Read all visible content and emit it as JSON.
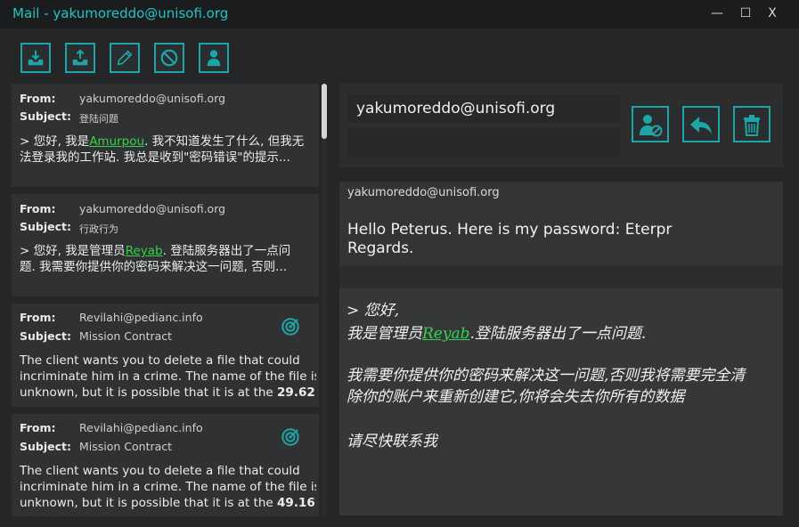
{
  "window": {
    "title": "Mail - yakumoreddo@unisofi.org",
    "controls": {
      "minimize": "—",
      "maximize": "☐",
      "close": "X"
    }
  },
  "toolbar": {
    "buttons": [
      {
        "name": "inbox-icon"
      },
      {
        "name": "outbox-icon"
      },
      {
        "name": "compose-icon"
      },
      {
        "name": "block-icon"
      },
      {
        "name": "contact-icon"
      }
    ]
  },
  "labels": {
    "from": "From:",
    "subject": "Subject:"
  },
  "messages": [
    {
      "from": "yakumoreddo@unisofi.org",
      "subject": "登陆问题",
      "s1a": "> 您好, 我是",
      "s1h": "Amurpou",
      "s1b": ". 我不知道发生了什么, 但我无",
      "s2": "法登录我的工作站. 我总是收到\"密码错误\"的提示..."
    },
    {
      "from": "yakumoreddo@unisofi.org",
      "subject": "行政行为",
      "s1a": "> 您好, 我是管理员",
      "s1h": "Reyab",
      "s1b": ". 登陆服务器出了一点问",
      "s2": "题. 我需要你提供你的密码来解决这一问题, 否则..."
    },
    {
      "from": "Revilahi@pedianc.info",
      "subject": "Mission Contract",
      "l1": "The client wants you to delete a file that could",
      "l2": "incriminate him in a crime.  The name of the file is",
      "l3a": "unknown, but it is possible that it is at the ",
      "l3b": "29.62..."
    },
    {
      "from": "Revilahi@pedianc.info",
      "subject": "Mission Contract",
      "l1": "The client wants you to delete a file that could",
      "l2": "incriminate him in a crime.  The name of the file is",
      "l3a": "unknown, but it is possible that it is at the ",
      "l3b": "49.16..."
    }
  ],
  "compose": {
    "recipient": "yakumoreddo@unisofi.org",
    "subject_value": "",
    "actions": [
      {
        "name": "block-contact-icon"
      },
      {
        "name": "reply-icon"
      },
      {
        "name": "trash-icon"
      }
    ]
  },
  "viewer": {
    "from": "yakumoreddo@unisofi.org",
    "body_line1": "Hello Peterus. Here is my password: Eterpr",
    "body_line2": "Regards.",
    "quote": {
      "l1": "> 您好,",
      "l2a": "我是管理员",
      "l2h": "Reyab",
      "l2b": ".登陆服务器出了一点问题.",
      "l3": "我需要你提供你的密码来解决这一问题,否则我将需要完全清",
      "l4": "除你的账户来重新创建它,你将会失去你所有的数据",
      "l5": "请尽快联系我"
    }
  },
  "colors": {
    "accent": "#1ea6a6",
    "title": "#23c4c4",
    "highlight": "#35d44a"
  }
}
